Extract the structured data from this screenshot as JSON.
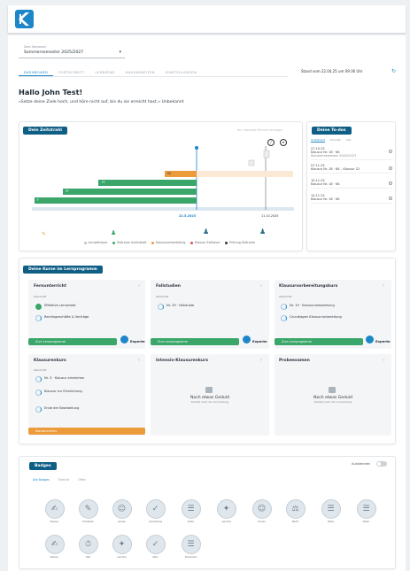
{
  "header": {
    "logo": "kurs-logo-icon"
  },
  "semester": {
    "label": "Dein Semester",
    "value": "Sommersemester 2025/2027"
  },
  "tabs": [
    "Dashboard",
    "Fortschritt",
    "Lernpfad",
    "Hausarbeiten",
    "Einstellungen"
  ],
  "status": {
    "stand": "Stand vom 22.04.25 um 09:36 Uhr"
  },
  "greeting": {
    "title": "Hallo John Test!",
    "subtitle": "«Setze deine Ziele hoch, und höre nicht auf, bis du sie erreicht hast.» Unbekannt"
  },
  "zeitstrahl": {
    "title": "Dein Zeitstrahl",
    "toggle_label": "Nur relevante Termine anzeigen",
    "today_label": "22.5.2025",
    "end_label": "11.10.2025",
    "bars": [
      {
        "label": "FF",
        "color": "#3aa669"
      },
      {
        "label": "FF",
        "color": "#3aa669"
      },
      {
        "label": "F",
        "color": "#3aa669"
      },
      {
        "label": "KK",
        "color": "#ec9b3b"
      }
    ],
    "legend": [
      "Lernzeitraum",
      "Zeitraum Aufenthalt",
      "Klausurvorbereitung",
      "Klausur Zeitraum",
      "Prüfung Zeitraum"
    ],
    "legend_colors": [
      "#b9c3cb",
      "#3aa669",
      "#ec9b3b",
      "#d9534f",
      "#333333"
    ]
  },
  "todos": {
    "title": "Deine To-dos",
    "tabs": [
      "Anstehend",
      "Erledigt",
      "Alle"
    ],
    "items": [
      {
        "date": "27.10.25",
        "text": "Klausur Nr. 18 · KK",
        "sub": "Sommersemester 2025/2027"
      },
      {
        "date": "07.11.25",
        "text": "Klausur Nr. 18 · KK – Klausur 22",
        "sub": ""
      },
      {
        "date": "10.11.25",
        "text": "Klausur Nr. 18 · KK",
        "sub": ""
      },
      {
        "date": "14.11.25",
        "text": "Klausur Nr. 18 · KK",
        "sub": ""
      }
    ]
  },
  "kurse": {
    "title": "Deine Kurse im Lernprogramm",
    "groups": [
      {
        "name": "Fernunterricht",
        "label": "Abschnitt",
        "items": [
          "Effektive Lernarbeit",
          "Rechtsgeschäfte & Verträge"
        ],
        "footer": "Zum Lernprogramm",
        "expert": "Experte"
      },
      {
        "name": "Fallstudien",
        "label": "Abschnitt",
        "items": [
          "Nr. 29 · Fallstudie"
        ],
        "footer": "Zum Lernprogramm",
        "expert": "Experte"
      },
      {
        "name": "Klausurvorbereitungskurs",
        "label": "Abschnitt",
        "items": [
          "Nr. 19 · Klausurvorbereitung",
          "Grundlagen Klausurvorbereitung"
        ],
        "footer": "Zum Lernprogramm",
        "expert": "Experte"
      },
      {
        "name": "Klausurenkurs",
        "label": "Abschnitt",
        "items": [
          "Nr. 3 · Klausur einreichen",
          "Klausur zur Einreichung",
          "Ende der Bearbeitung"
        ],
        "footer": "Klausurenkurs"
      },
      {
        "name": "Intensiv-Klausurenkurs",
        "lock": "Noch etwas Geduld",
        "lock_sub": "Startet nach der Anmeldung"
      },
      {
        "name": "Probeexamen",
        "lock": "Noch etwas Geduld",
        "lock_sub": "Startet nach der Anmeldung"
      }
    ]
  },
  "badges": {
    "title": "Badges",
    "toggle_label": "Ausblenden",
    "tabs": [
      "Alle Badges",
      "Erreicht",
      "Offen"
    ],
    "items": [
      "Klausur",
      "Schreiben",
      "Lernen",
      "Anmeldung",
      "Akten",
      "Lernziel",
      "Lernen",
      "Recht",
      "Akten",
      "Akten",
      "Klausur",
      "Zeit",
      "Lernziel",
      "Aktiv",
      "Dokument"
    ]
  }
}
